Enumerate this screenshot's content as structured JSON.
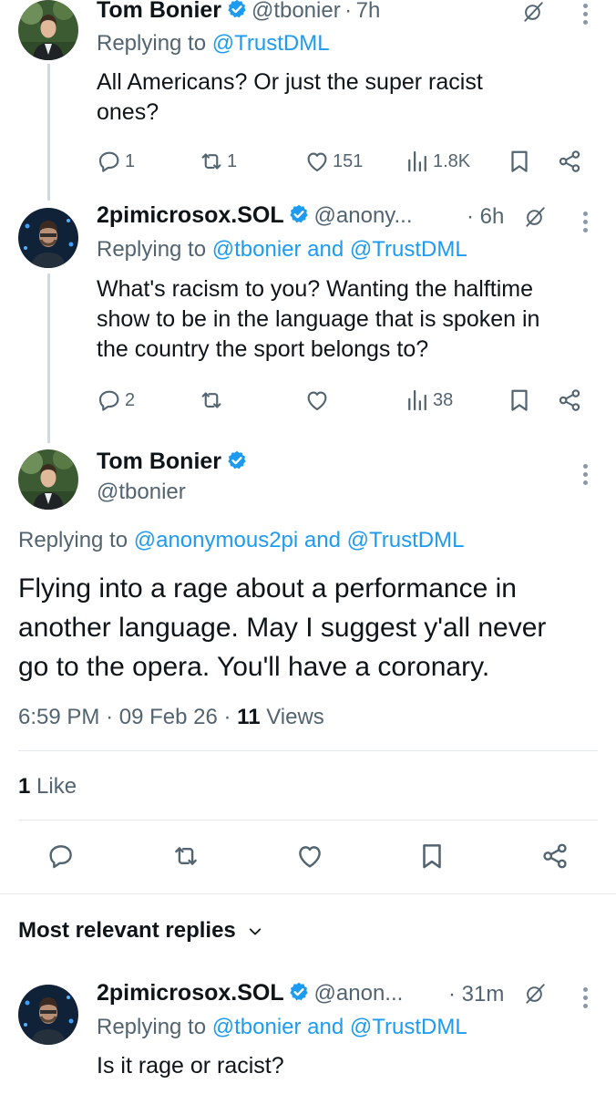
{
  "tweets": [
    {
      "name": "Tom Bonier",
      "handle": "@tbonier",
      "sep": "·",
      "time": "7h",
      "replying_label": "Replying to",
      "replying_to": "@TrustDML",
      "text_line1": "All Americans? Or just the super racist",
      "text_line2": "ones?",
      "replies": "1",
      "retweets": "1",
      "likes": "151",
      "views": "1.8K"
    },
    {
      "name": "2pimicrosox.SOL",
      "handle": "@anony...",
      "sep": "·",
      "time": "6h",
      "replying_label": "Replying to",
      "replying_to_1": "@tbonier",
      "and": "and",
      "replying_to_2": "@TrustDML",
      "text_line1": "What's racism to you? Wanting the halftime",
      "text_line2": "show to be in the language that is spoken in",
      "text_line3": "the country the sport belongs to?",
      "replies": "2",
      "retweets": "",
      "likes": "",
      "views": "38"
    }
  ],
  "main_tweet": {
    "name": "Tom Bonier",
    "handle": "@tbonier",
    "replying_label": "Replying to",
    "replying_to_1": "@anonymous2pi",
    "and": "and",
    "replying_to_2": "@TrustDML",
    "text_line1": "Flying into a rage about a performance in",
    "text_line2": "another language. May I suggest y'all never",
    "text_line3": "go to the opera. You'll have a coronary.",
    "time": "6:59 PM",
    "sep": "·",
    "date": "09 Feb 26",
    "views_count": "11",
    "views_label": "Views",
    "likes_count": "1",
    "likes_label": "Like"
  },
  "replies_section": {
    "label": "Most relevant replies"
  },
  "bottom_reply": {
    "name": "2pimicrosox.SOL",
    "handle": "@anon...",
    "sep": "·",
    "time": "31m",
    "replying_label": "Replying to",
    "replying_to_1": "@tbonier",
    "and": "and",
    "replying_to_2": "@TrustDML",
    "text_line1": "Is it rage or racist?"
  },
  "colors": {
    "link": "#1d9bf0",
    "secondary": "#536471",
    "verified": "#1d9bf0"
  },
  "icons": [
    "reply-icon",
    "retweet-icon",
    "like-icon",
    "views-icon",
    "bookmark-icon",
    "share-icon",
    "grok-icon",
    "more-icon",
    "verified-icon",
    "chevron-down-icon"
  ]
}
